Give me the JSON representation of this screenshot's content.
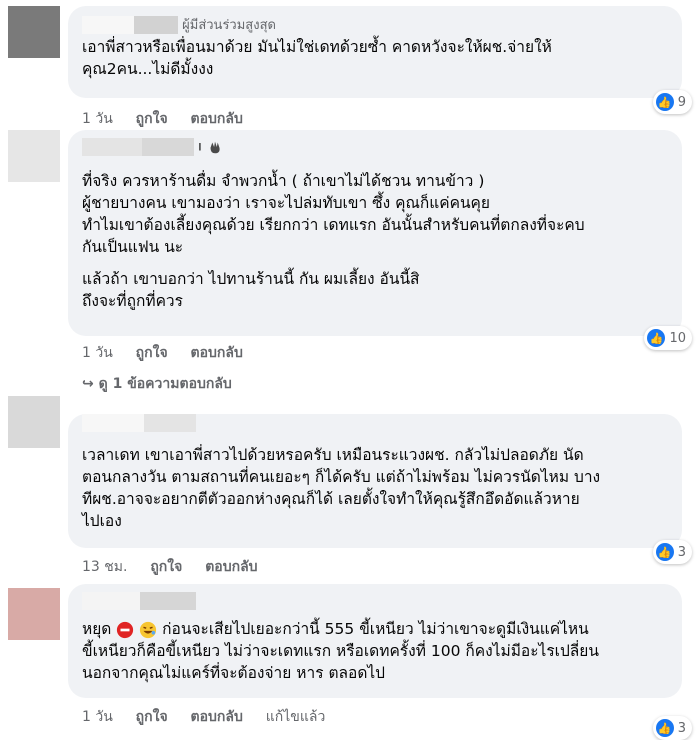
{
  "comments": [
    {
      "badge": "ผู้มีส่วนร่วมสูงสุด",
      "text": "เอาพี่สาวหรือเพื่อนมาด้วย มันไม่ใช่เดทด้วยซ้ำ คาดหวังจะให้ผช.จ่ายให้\nคุณ2คน...ไม่ดีมั้งงง",
      "time": "1 วัน",
      "like": "ถูกใจ",
      "reply": "ตอบกลับ",
      "reactions": "9",
      "avatar_color": "#7a7a7a"
    },
    {
      "name_suffix": "ı",
      "text_p1": "ที่จริง ควรหาร้านดื่ม จำพวกน้ำ ( ถ้าเขาไม่ได้ชวน ทานข้าว )\nผู้ชายบางคน เขามองว่า เราจะไปล่มทับเขา ซึ้ง คุณก็แค่คนคุย\nทำไมเขาต้องเลี้ยงคุณด้วย เรียกกว่า เดทแรก อันนั้นสำหรับคนที่ตกลงที่จะคบ\nกันเป็นแฟน นะ",
      "text_p2": "แล้วถ้า เขาบอกว่า ไปทานร้านนี้ กัน ผมเลี้ยง อันนี้สิ\nถึงจะที่ถูกที่ควร",
      "time": "1 วัน",
      "like": "ถูกใจ",
      "reply": "ตอบกลับ",
      "reactions": "10",
      "view_replies": "ดู 1 ข้อความตอบกลับ",
      "avatar_color": "#e6e6e6"
    },
    {
      "text": "เวลาเดท เขาเอาพี่สาวไปด้วยหรอครับ เหมือนระแวงผช. กลัวไม่ปลอดภัย นัด\nตอนกลางวัน ตามสถานที่คนเยอะๆ ก็ได้ครับ แต่ถ้าไม่พร้อม ไม่ควรนัดไหม บาง\nทีผช.อาจจะอยากตีตัวออกห่างคุณก็ได้ เลยตั้งใจทำให้คุณรู้สึกอึดอัดแล้วหาย\nไปเอง",
      "time": "13 ชม.",
      "like": "ถูกใจ",
      "reply": "ตอบกลับ",
      "reactions": "3",
      "avatar_color": "#d9d9d9"
    },
    {
      "text_start": "หยุด",
      "text_rest": " ก่อนจะเสียไปเยอะกว่านี้ 555 ขี้เหนียว ไม่ว่าเขาจะดูมีเงินแค่ไหน\nขี้เหนียวก็คือขี้เหนียว ไม่ว่าจะเดทแรก หรือเดทครั้งที่ 100 ก็คงไม่มีอะไรเปลี่ยน\nนอกจากคุณไม่แคร์ที่จะต้องจ่าย หาร ตลอดไป",
      "time": "1 วัน",
      "like": "ถูกใจ",
      "reply": "ตอบกลับ",
      "edited": "แก้ไขแล้ว",
      "reactions": "3",
      "avatar_color": "#d8aaa6"
    }
  ],
  "colors": {
    "like_blue": "#1877f2",
    "bubble_bg": "#f0f2f5",
    "meta_grey": "#65676b"
  },
  "icons": [
    "like-icon",
    "wave-hand-icon",
    "stop-sign-icon",
    "laughing-emoji-icon",
    "reply-arrow-icon"
  ]
}
